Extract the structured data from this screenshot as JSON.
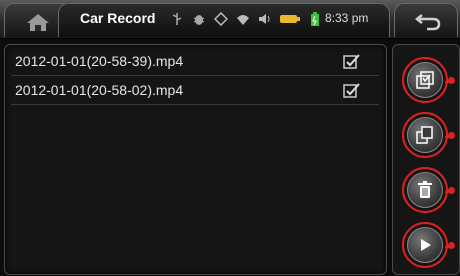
{
  "header": {
    "title": "Car Record",
    "time": "8:33 pm",
    "icons": [
      "home-icon",
      "usb-icon",
      "debug-bug-icon",
      "gps-icon",
      "wifi-icon",
      "volume-icon",
      "battery-icon",
      "charging-battery-icon",
      "back-icon"
    ]
  },
  "files": [
    {
      "name": "2012-01-01(20-58-39).mp4"
    },
    {
      "name": "2012-01-01(20-58-02).mp4"
    }
  ],
  "side_buttons": [
    "select-all-icon",
    "copy-icon",
    "trash-icon",
    "play-icon"
  ],
  "colors": {
    "highlight": "#e02020",
    "background": "#0c0c0c"
  }
}
